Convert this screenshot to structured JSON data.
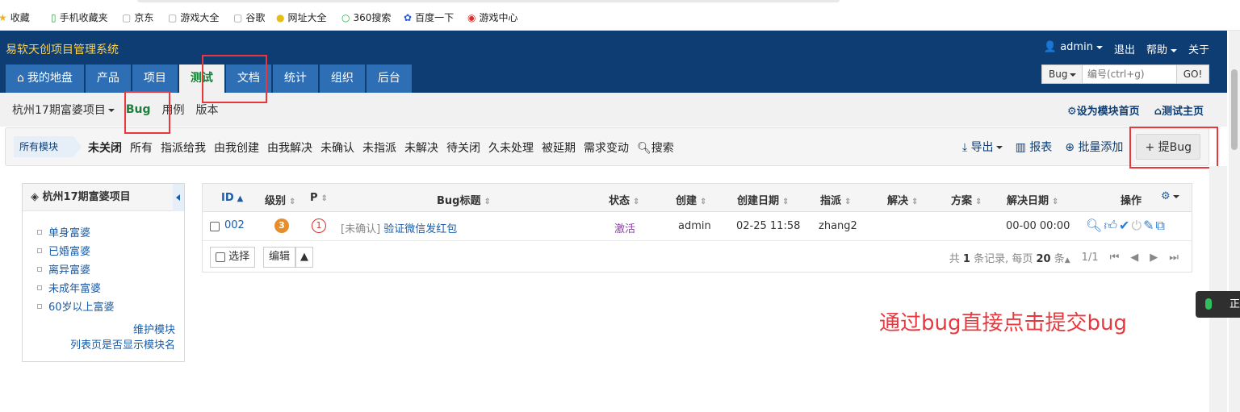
{
  "bookmarks": [
    {
      "label": "收藏",
      "icon": "star-icon"
    },
    {
      "label": "手机收藏夹",
      "icon": "phone-icon"
    },
    {
      "label": "京东",
      "icon": "page-icon"
    },
    {
      "label": "游戏大全",
      "icon": "page-icon"
    },
    {
      "label": "谷歌",
      "icon": "page-icon"
    },
    {
      "label": "网址大全",
      "icon": "globe-icon"
    },
    {
      "label": "360搜索",
      "icon": "search-360-icon"
    },
    {
      "label": "百度一下",
      "icon": "paw-icon"
    },
    {
      "label": "游戏中心",
      "icon": "game-icon"
    }
  ],
  "header": {
    "app_title": "易软天创项目管理系统",
    "user": "admin",
    "logout": "退出",
    "help": "帮助",
    "about": "关于"
  },
  "nav": {
    "tabs": [
      {
        "label": "我的地盘",
        "icon": "home-icon"
      },
      {
        "label": "产品"
      },
      {
        "label": "项目"
      },
      {
        "label": "测试",
        "active": true
      },
      {
        "label": "文档"
      },
      {
        "label": "统计"
      },
      {
        "label": "组织"
      },
      {
        "label": "后台"
      }
    ]
  },
  "search": {
    "type": "Bug",
    "placeholder": "编号(ctrl+g)",
    "go": "GO!"
  },
  "subnav": {
    "project": "杭州17期富婆项目",
    "items": [
      "Bug",
      "用例",
      "版本"
    ],
    "set_home": "设为模块首页",
    "test_home": "测试主页"
  },
  "featurebar": {
    "module_chip": "所有模块",
    "filters": [
      "未关闭",
      "所有",
      "指派给我",
      "由我创建",
      "由我解决",
      "未确认",
      "未指派",
      "未解决",
      "待关闭",
      "久未处理",
      "被延期",
      "需求变动"
    ],
    "search": "搜索",
    "export": "导出",
    "report": "报表",
    "batch_add": "批量添加",
    "report_bug": "提Bug"
  },
  "sidebar": {
    "title": "杭州17期富婆项目",
    "modules": [
      "单身富婆",
      "已婚富婆",
      "离异富婆",
      "未成年富婆",
      "60岁以上富婆"
    ],
    "maintain": "维护模块",
    "show_module_name": "列表页是否显示模块名"
  },
  "table": {
    "columns": [
      "ID",
      "级别",
      "P",
      "Bug标题",
      "状态",
      "创建",
      "创建日期",
      "指派",
      "解决",
      "方案",
      "解决日期",
      "操作"
    ],
    "rows": [
      {
        "id": "002",
        "severity": "3",
        "priority": "1",
        "title_prefix": "[未确认]",
        "title": "验证微信发红包",
        "status": "激活",
        "creator": "admin",
        "created": "02-25 11:58",
        "assigned": "zhang2",
        "resolved_by": "",
        "resolution": "",
        "resolved_date": "00-00 00:00"
      }
    ],
    "footer": {
      "select": "选择",
      "edit": "编辑",
      "total_prefix": "共",
      "total": "1",
      "total_suffix": "条记录,",
      "per_page_prefix": "每页",
      "per_page": "20",
      "per_page_suffix": "条",
      "page": "1/1"
    }
  },
  "annotation": "通过bug直接点击提交bug",
  "voice_widget": "正",
  "colors": {
    "header_bg": "#0e3d73",
    "title_yellow": "#ffd34c",
    "active_green": "#1d7f3c",
    "link_blue": "#1a5ca8",
    "annotation_red": "#e8383d"
  }
}
